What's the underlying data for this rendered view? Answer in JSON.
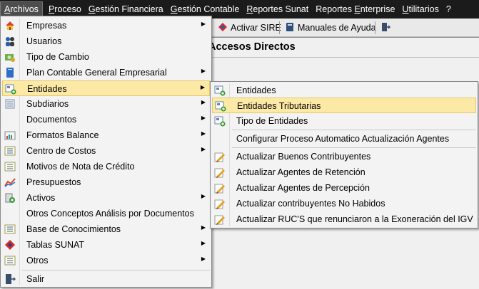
{
  "menubar": [
    {
      "label_u": "A",
      "label_rest": "rchivos",
      "name": "menu-archivos",
      "active": true
    },
    {
      "label_u": "P",
      "label_rest": "roceso",
      "name": "menu-proceso"
    },
    {
      "label_u": "G",
      "label_rest": "estión Financiera",
      "name": "menu-gestion-financiera"
    },
    {
      "label_u": "G",
      "label_rest": "estión Contable",
      "name": "menu-gestion-contable"
    },
    {
      "label_u": "R",
      "label_rest": "eportes Sunat",
      "name": "menu-reportes-sunat"
    },
    {
      "label_pre": "Reportes ",
      "label_u": "E",
      "label_rest": "nterprise",
      "name": "menu-reportes-enterprise"
    },
    {
      "label_u": "U",
      "label_rest": "tilitarios",
      "name": "menu-utilitarios"
    },
    {
      "label_u": "",
      "label_rest": "?",
      "name": "menu-help"
    }
  ],
  "toolbar": {
    "activar_sire": "Activar SIRE",
    "manuales": "Manuales de Ayuda"
  },
  "content": {
    "title": "Accesos Directos"
  },
  "archivos_menu": [
    {
      "label": "Empresas",
      "icon": "house-icon",
      "submenu": true
    },
    {
      "label": "Usuarios",
      "icon": "users-icon",
      "submenu": false
    },
    {
      "label": "Tipo de Cambio",
      "icon": "exchange-icon",
      "submenu": false
    },
    {
      "label": "Plan Contable General Empresarial",
      "icon": "book-icon",
      "submenu": true
    },
    {
      "label": "Entidades",
      "icon": "entities-icon",
      "submenu": true,
      "highlight": true
    },
    {
      "label": "Subdiarios",
      "icon": "ledger-icon",
      "submenu": true
    },
    {
      "label": "Documentos",
      "icon": "",
      "submenu": true
    },
    {
      "label": "Formatos Balance",
      "icon": "balance-icon",
      "submenu": true
    },
    {
      "label": "Centro de Costos",
      "icon": "list-icon",
      "submenu": true
    },
    {
      "label": "Motivos de Nota de Crédito",
      "icon": "list-icon",
      "submenu": false
    },
    {
      "label": "Presupuestos",
      "icon": "chart-line-icon",
      "submenu": false
    },
    {
      "label": "Activos",
      "icon": "assets-icon",
      "submenu": true
    },
    {
      "label": "Otros Conceptos Análisis por Documentos",
      "icon": "",
      "submenu": false
    },
    {
      "label": "Base de Conocimientos",
      "icon": "list-icon",
      "submenu": true
    },
    {
      "label": "Tablas SUNAT",
      "icon": "sunat-icon",
      "submenu": true
    },
    {
      "label": "Otros",
      "icon": "list-icon",
      "submenu": true
    },
    {
      "label": "Salir",
      "icon": "exit-icon",
      "submenu": false
    }
  ],
  "entidades_menu": [
    {
      "label": "Entidades",
      "icon": "entities-icon"
    },
    {
      "label": "Entidades Tributarias",
      "icon": "entities-icon",
      "highlight": true
    },
    {
      "label": "Tipo de Entidades",
      "icon": "entities-icon"
    },
    {
      "label": "Configurar Proceso Automatico Actualización Agentes",
      "icon": ""
    },
    {
      "label": "Actualizar Buenos Contribuyentes",
      "icon": "edit-icon"
    },
    {
      "label": "Actualizar Agentes de Retención",
      "icon": "edit-icon"
    },
    {
      "label": "Actualizar Agentes de Percepción",
      "icon": "edit-icon"
    },
    {
      "label": "Actualizar contribuyentes No Habidos",
      "icon": "edit-icon"
    },
    {
      "label": "Actualizar RUC'S que renunciaron a la Exoneración del IGV",
      "icon": "edit-icon"
    }
  ]
}
